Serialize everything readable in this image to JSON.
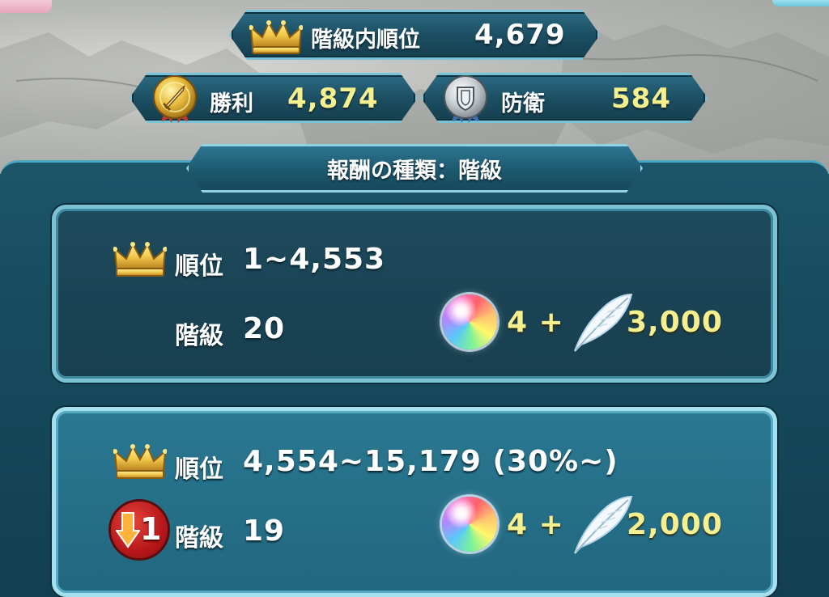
{
  "stats": {
    "tier_rank_label": "階級内順位",
    "tier_rank_value": "4,679",
    "wins_label": "勝利",
    "wins_value": "4,874",
    "defense_label": "防衛",
    "defense_value": "584"
  },
  "section": {
    "title": "報酬の種類：階級"
  },
  "rewards": [
    {
      "rank_label": "順位",
      "rank_range": "1~4,553",
      "tier_label": "階級",
      "tier_value": "20",
      "orbs": "4 +",
      "feathers": "3,000",
      "rank_change": null
    },
    {
      "rank_label": "順位",
      "rank_range": "4,554~15,179 (30%~)",
      "tier_label": "階級",
      "tier_value": "19",
      "orbs": "4 +",
      "feathers": "2,000",
      "rank_change": "1"
    }
  ],
  "icons": {
    "crown": "crown-icon",
    "win_medal": "gold-sword-medal-icon",
    "defense_medal": "silver-shield-medal-icon",
    "orb": "orb-icon",
    "feather": "feather-icon",
    "rank_down": "rank-down-arrow-icon"
  },
  "colors": {
    "accent_yellow": "#f6ef8e",
    "panel_teal": "#164a5d",
    "border_cyan": "#79c3d8"
  }
}
